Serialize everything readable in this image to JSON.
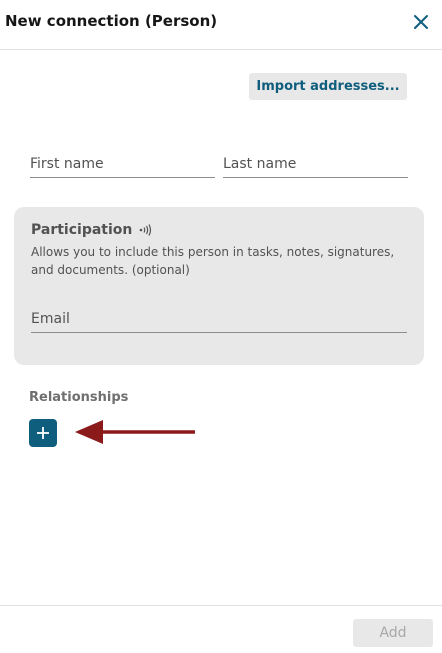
{
  "dialog": {
    "title": "New connection (Person)"
  },
  "import_button": {
    "label": "Import addresses..."
  },
  "name_fields": {
    "first_name_placeholder": "First name",
    "first_name_value": "",
    "last_name_placeholder": "Last name",
    "last_name_value": ""
  },
  "participation": {
    "title": "Participation",
    "icon": "broadcast-icon",
    "description": "Allows you to include this person in tasks, notes, signatures, and documents. (optional)",
    "email_placeholder": "Email",
    "email_value": ""
  },
  "relationships": {
    "label": "Relationships"
  },
  "footer": {
    "add_label": "Add",
    "add_enabled": false
  },
  "colors": {
    "accent": "#0f5e7d",
    "annotation_arrow": "#8b1a1a",
    "card_background": "#e8e8e8"
  }
}
